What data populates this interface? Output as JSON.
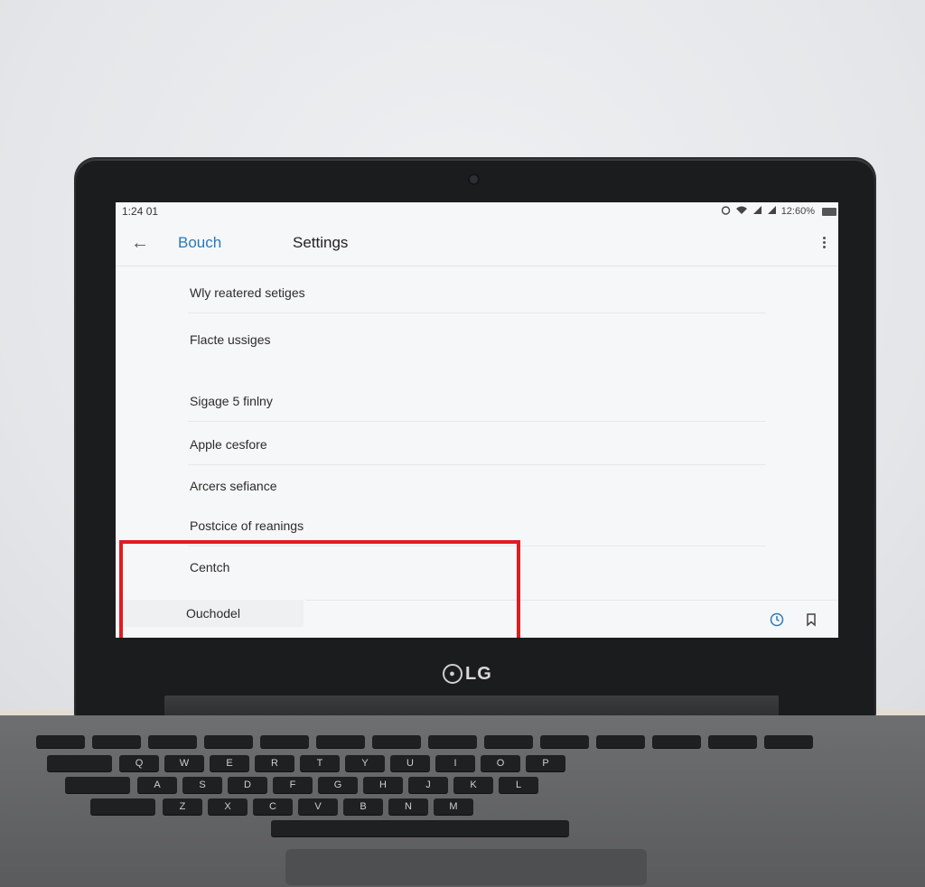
{
  "status_bar": {
    "time": "1:24 01",
    "right_text": "12:60%",
    "icons": [
      "alarm-icon",
      "wifi-icon",
      "signal-icon",
      "signal-icon"
    ]
  },
  "app_bar": {
    "back_label": "Bouch",
    "title": "Settings"
  },
  "settings_items": [
    {
      "label": "Wly reatered setiges"
    },
    {
      "label": "Flacte ussiges"
    },
    {
      "label": "Sigage 5 finlny"
    },
    {
      "label": "Apple cesfore"
    },
    {
      "label": "Arcers sefiance"
    },
    {
      "label": "Postcice of reanings"
    },
    {
      "label": "Centch"
    }
  ],
  "bottom_item": {
    "label": "Ouchodel"
  },
  "device": {
    "brand": "LG"
  },
  "keyboard": {
    "row1": [
      "Q",
      "W",
      "E",
      "R",
      "T",
      "Y",
      "U",
      "I",
      "O",
      "P"
    ],
    "row2": [
      "A",
      "S",
      "D",
      "F",
      "G",
      "H",
      "J",
      "K",
      "L"
    ],
    "row3": [
      "Z",
      "X",
      "C",
      "V",
      "B",
      "N",
      "M"
    ]
  },
  "colors": {
    "highlight": "#e01b22",
    "accent": "#2a79b8",
    "screen_bg": "#f6f7f8",
    "bezel": "#1b1c1e"
  }
}
